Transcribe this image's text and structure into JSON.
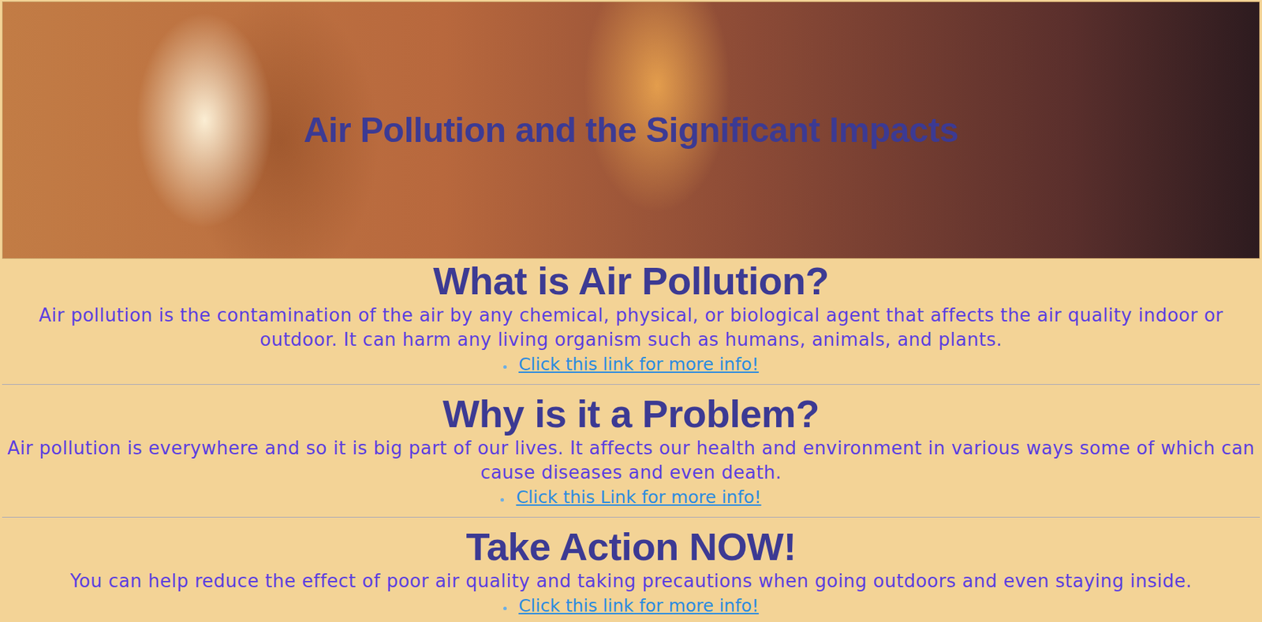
{
  "header": {
    "title": "Air Pollution and the Significant Impacts"
  },
  "sections": [
    {
      "title": "What is Air Pollution?",
      "text": "Air pollution is the contamination of the air by any chemical, physical, or biological agent that affects the air quality indoor or outdoor. It can harm any living organism such as humans, animals, and plants.",
      "link": "Click this link for more info!"
    },
    {
      "title": "Why is it a Problem?",
      "text": "Air pollution is everywhere and so it is big part of our lives. It affects our health and environment in various ways some of which can cause diseases and even death.",
      "link": "Click this Link for more info!"
    },
    {
      "title": "Take Action NOW!",
      "text": "You can help reduce the effect of poor air quality and taking precautions when going outdoors and even staying inside.",
      "link": "Click this link for more info!"
    }
  ]
}
